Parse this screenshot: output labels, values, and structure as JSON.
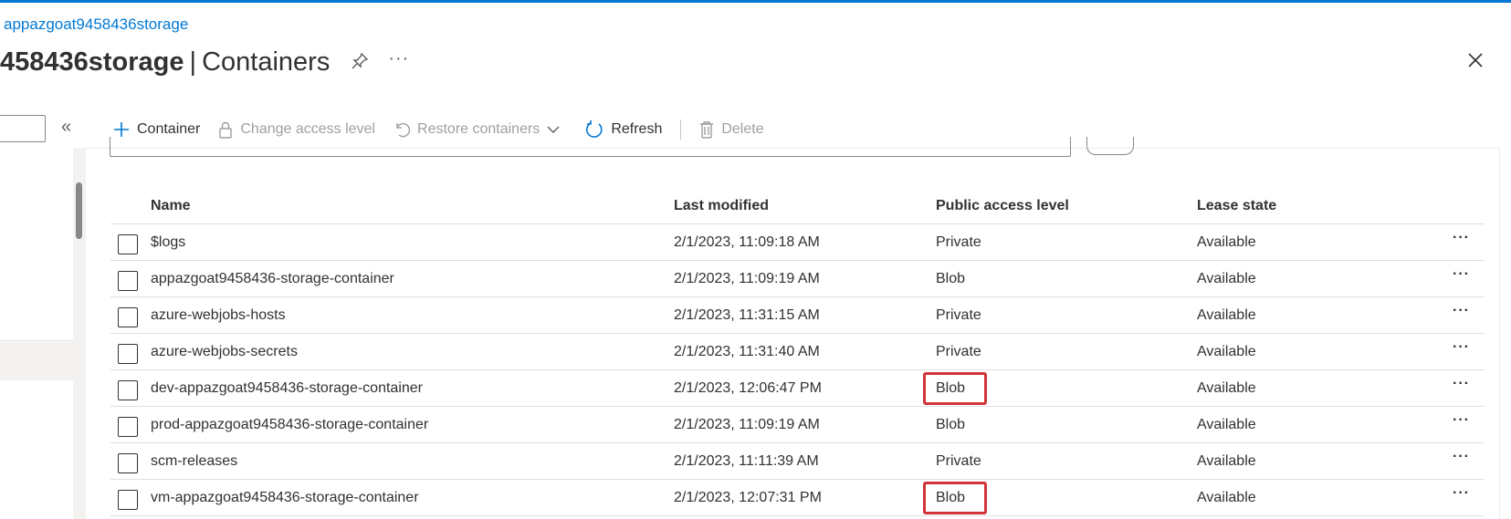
{
  "breadcrumb": "appazgoat9458436storage",
  "header": {
    "title_bold": "458436storage",
    "title_sep": "|",
    "title_rest": "Containers",
    "more": "···"
  },
  "toolbar": {
    "container_label": "Container",
    "change_access_label": "Change access level",
    "restore_label": "Restore containers",
    "refresh_label": "Refresh",
    "delete_label": "Delete"
  },
  "table": {
    "headers": {
      "name": "Name",
      "last_modified": "Last modified",
      "access": "Public access level",
      "lease": "Lease state"
    },
    "rows": [
      {
        "name": "$logs",
        "last_modified": "2/1/2023, 11:09:18 AM",
        "access": "Private",
        "lease": "Available",
        "more": "···",
        "highlight": false
      },
      {
        "name": "appazgoat9458436-storage-container",
        "last_modified": "2/1/2023, 11:09:19 AM",
        "access": "Blob",
        "lease": "Available",
        "more": "···",
        "highlight": false
      },
      {
        "name": "azure-webjobs-hosts",
        "last_modified": "2/1/2023, 11:31:15 AM",
        "access": "Private",
        "lease": "Available",
        "more": "···",
        "highlight": false
      },
      {
        "name": "azure-webjobs-secrets",
        "last_modified": "2/1/2023, 11:31:40 AM",
        "access": "Private",
        "lease": "Available",
        "more": "···",
        "highlight": false
      },
      {
        "name": "dev-appazgoat9458436-storage-container",
        "last_modified": "2/1/2023, 12:06:47 PM",
        "access": "Blob",
        "lease": "Available",
        "more": "···",
        "highlight": true
      },
      {
        "name": "prod-appazgoat9458436-storage-container",
        "last_modified": "2/1/2023, 11:09:19 AM",
        "access": "Blob",
        "lease": "Available",
        "more": "···",
        "highlight": false
      },
      {
        "name": "scm-releases",
        "last_modified": "2/1/2023, 11:11:39 AM",
        "access": "Private",
        "lease": "Available",
        "more": "···",
        "highlight": false
      },
      {
        "name": "vm-appazgoat9458436-storage-container",
        "last_modified": "2/1/2023, 12:07:31 PM",
        "access": "Blob",
        "lease": "Available",
        "more": "···",
        "highlight": true
      }
    ]
  },
  "colors": {
    "accent": "#0078d4",
    "highlight": "#d13438",
    "disabled_text": "#a19f9d"
  },
  "icons": {
    "pin": "pin-icon",
    "close": "close-icon",
    "collapse": "double-chevron-left-icon",
    "add": "plus-icon",
    "lock": "lock-icon",
    "restore": "undo-icon",
    "refresh": "refresh-icon",
    "delete": "trash-icon",
    "more": "more-icon"
  },
  "sidebar": {
    "collapse_glyph": "«"
  }
}
